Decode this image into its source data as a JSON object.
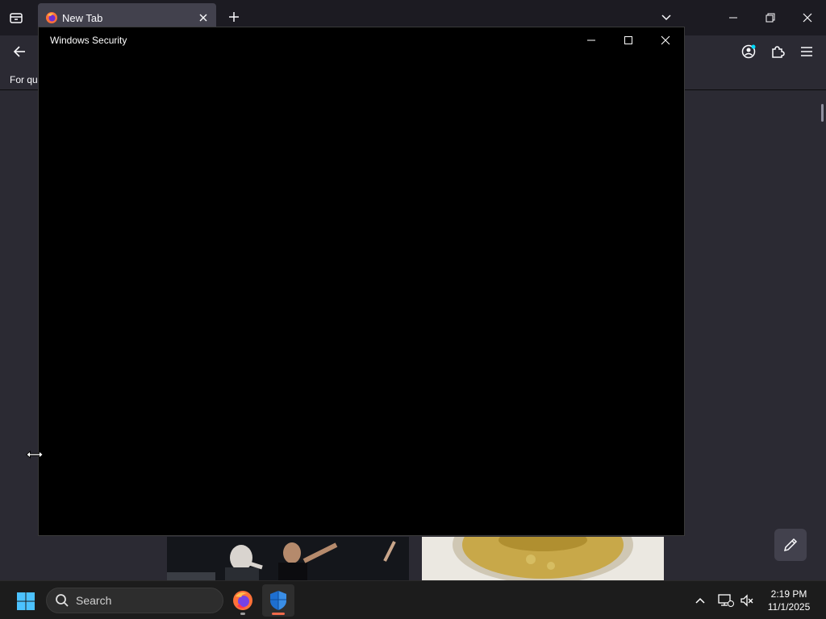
{
  "browser": {
    "tab": {
      "title": "New Tab"
    },
    "bookmarks_bar": {
      "text": "For quick access, place your bookmarks here on the bookmarks toolbar."
    }
  },
  "security_window": {
    "title": "Windows Security"
  },
  "taskbar": {
    "search_label": "Search",
    "time": "2:19 PM",
    "date": "11/1/2025",
    "apps": [
      "firefox-icon",
      "windows-security-icon"
    ]
  },
  "colors": {
    "tabbar_bg": "#1c1b22",
    "toolbar_bg": "#2b2a33",
    "window_bg": "#000000",
    "taskbar_bg": "#1c1c1c",
    "accent_active": "#f06a4a"
  }
}
